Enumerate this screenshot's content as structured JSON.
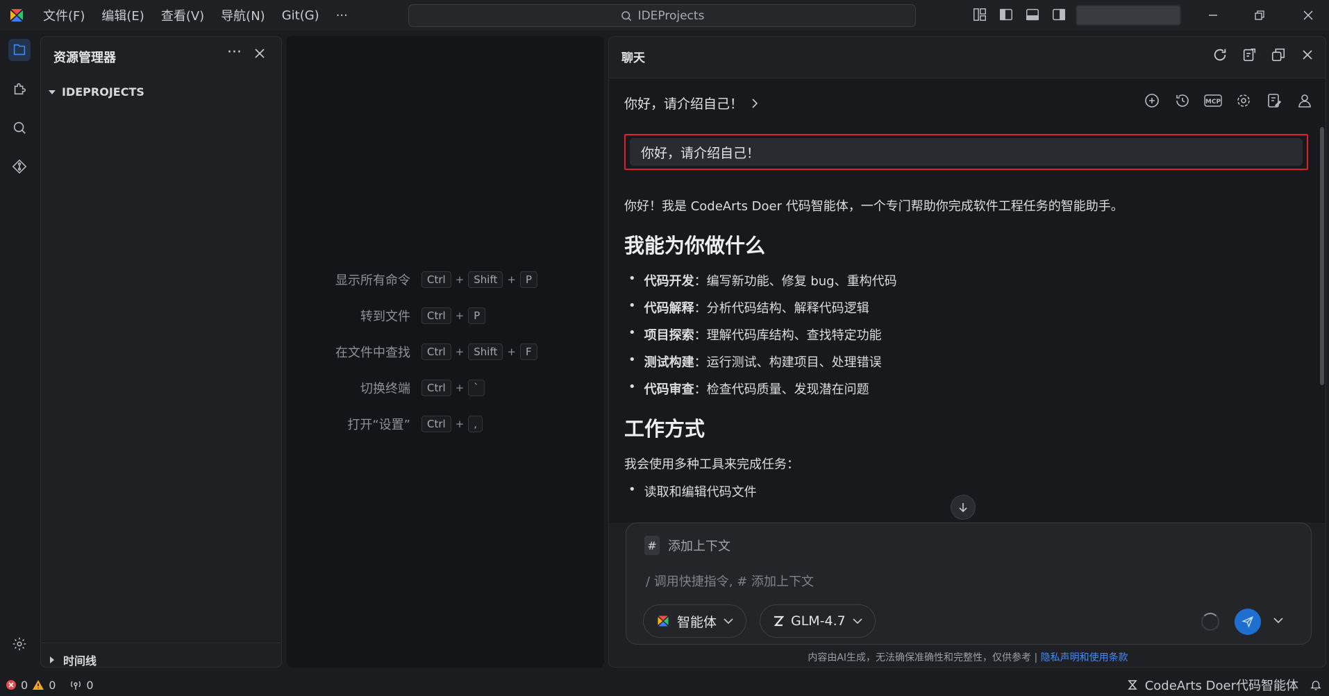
{
  "menu": [
    "文件(F)",
    "编辑(E)",
    "查看(V)",
    "导航(N)",
    "Git(G)",
    "···"
  ],
  "search": {
    "label": "IDEProjects"
  },
  "colors": {
    "accent": "#1f6fd1",
    "highlight_border": "#e0202a",
    "link": "#3f8cff"
  },
  "explorer": {
    "title": "资源管理器",
    "more": "···",
    "root": "IDEPROJECTS",
    "timeline": "时间线"
  },
  "shortcuts": [
    {
      "label": "显示所有命令",
      "keys": [
        "Ctrl",
        "Shift",
        "P"
      ]
    },
    {
      "label": "转到文件",
      "keys": [
        "Ctrl",
        "P"
      ]
    },
    {
      "label": "在文件中查找",
      "keys": [
        "Ctrl",
        "Shift",
        "F"
      ]
    },
    {
      "label": "切换终端",
      "keys": [
        "Ctrl",
        "`"
      ]
    },
    {
      "label": "打开“设置”",
      "keys": [
        "Ctrl",
        ","
      ]
    }
  ],
  "chat": {
    "title": "聊天",
    "crumb": "你好，请介绍自己！",
    "user_message": "你好，请介绍自己！",
    "intro": "你好！我是 CodeArts Doer 代码智能体，一个专门帮助你完成软件工程任务的智能助手。",
    "section1": "我能为你做什么",
    "items": [
      {
        "bold": "代码开发",
        "text": "：编写新功能、修复 bug、重构代码"
      },
      {
        "bold": "代码解释",
        "text": "：分析代码结构、解释代码逻辑"
      },
      {
        "bold": "项目探索",
        "text": "：理解代码库结构、查找特定功能"
      },
      {
        "bold": "测试构建",
        "text": "：运行测试、构建项目、处理错误"
      },
      {
        "bold": "代码审查",
        "text": "：检查代码质量、发现潜在问题"
      }
    ],
    "section2": "工作方式",
    "work_intro": "我会使用多种工具来完成任务：",
    "work_first": "读取和编辑代码文件",
    "composer": {
      "context_label": "添加上下文",
      "hash": "#",
      "placeholder": "/ 调用快捷指令, # 添加上下文",
      "agent_label": "智能体",
      "model_label": "GLM-4.7"
    },
    "disclaimer_text": "内容由AI生成，无法确保准确性和完整性，仅供参考  |",
    "disclaimer_link": "隐私声明和使用条款"
  },
  "status": {
    "errors": "0",
    "warnings": "0",
    "ports": "0",
    "agent": "CodeArts Doer代码智能体"
  }
}
